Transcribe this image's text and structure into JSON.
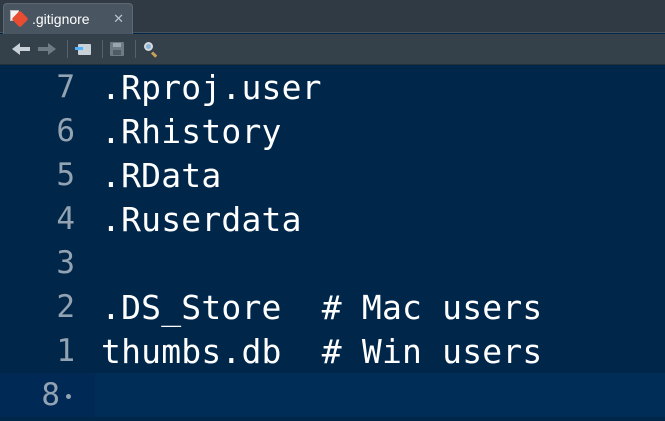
{
  "tab": {
    "filename": ".gitignore",
    "close_glyph": "✕",
    "icon": "git-file-icon"
  },
  "toolbar": {
    "buttons": [
      "back-icon",
      "forward-icon",
      "go-to-file-icon",
      "save-icon",
      "search-icon"
    ]
  },
  "editor": {
    "theme_background": "#00264a",
    "lines": [
      {
        "number": "7",
        "text": ".Rproj.user"
      },
      {
        "number": "6",
        "text": ".Rhistory"
      },
      {
        "number": "5",
        "text": ".RData"
      },
      {
        "number": "4",
        "text": ".Ruserdata"
      },
      {
        "number": "3",
        "text": ""
      },
      {
        "number": "2",
        "text": ".DS_Store  # Mac users"
      },
      {
        "number": "1",
        "text": "thumbs.db  # Win users"
      },
      {
        "number": "8",
        "text": ""
      }
    ]
  }
}
